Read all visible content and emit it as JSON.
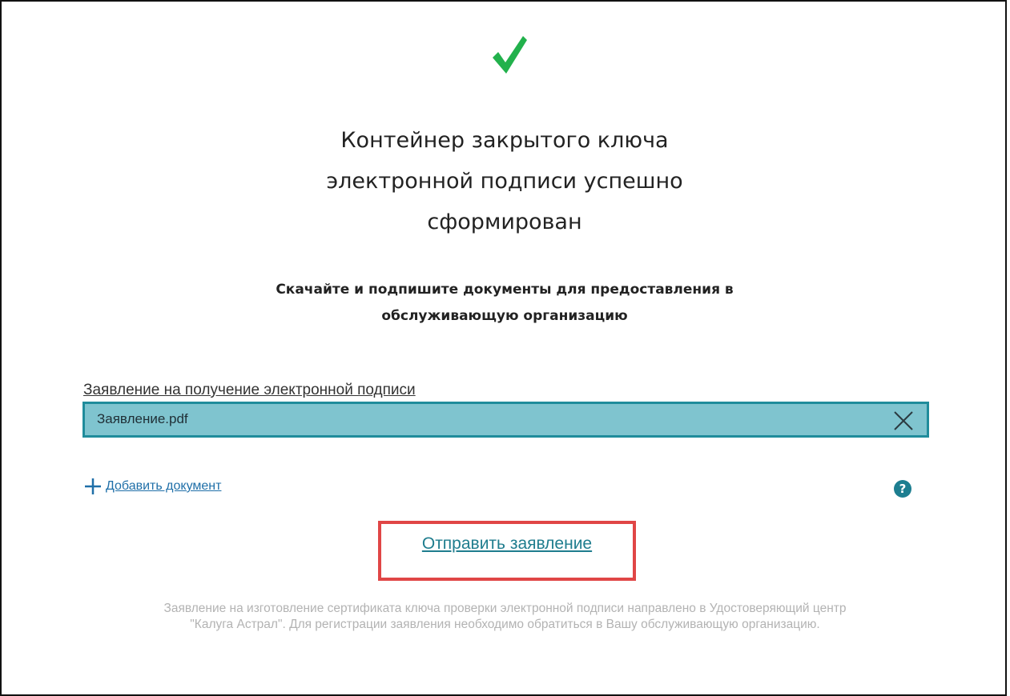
{
  "title_lines": [
    "Контейнер закрытого ключа",
    "электронной подписи успешно",
    "сформирован"
  ],
  "subtitle_lines": [
    "Скачайте и подпишите документы для предоставления в",
    "обслуживающую организацию"
  ],
  "document": {
    "label": "Заявление на получение электронной подписи",
    "file_name": "Заявление.pdf"
  },
  "add_document_label": "Добавить документ",
  "help_symbol": "?",
  "submit_label": "Отправить заявление",
  "notice_lines": [
    "Заявление на изготовление сертификата ключа проверки электронной подписи направлено в Удостоверяющий центр",
    "\"Калуга Астрал\". Для регистрации заявления необходимо обратиться в Вашу обслуживающую организацию."
  ],
  "icons": {
    "success": "checkmark-icon",
    "remove_file": "close-icon",
    "add": "plus-icon",
    "help": "help-icon"
  },
  "colors": {
    "check": "#22b14c",
    "file_box_bg": "#7fc4cf",
    "file_box_border": "#1f8c9b",
    "link": "#1f6fa8",
    "submit_link": "#1f7d8e",
    "highlight": "#e04646",
    "notice_text": "#b3b3b3"
  }
}
